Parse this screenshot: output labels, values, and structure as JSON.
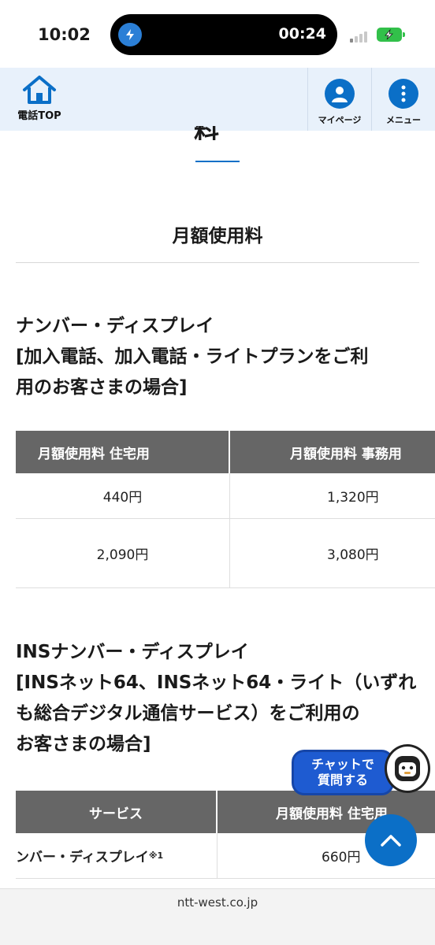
{
  "status_bar": {
    "time": "10:02",
    "timer": "00:24"
  },
  "nav": {
    "home_label": "電話TOP",
    "mypage_label": "マイページ",
    "menu_label": "メニュー"
  },
  "page": {
    "partial_heading": "料金",
    "section_title": "月額使用料",
    "subsection1": {
      "title_lines": [
        "ナンバー・ディスプレイ",
        "[加入電話、加入電話・ライトプランをご利",
        "用のお客さまの場合]"
      ],
      "headers": [
        "月額使用料 住宅用",
        "月額使用料 事務用"
      ],
      "rows": [
        [
          "440円",
          "1,320円"
        ],
        [
          "2,090円",
          "3,080円"
        ]
      ]
    },
    "subsection2": {
      "title_lines": [
        "INSナンバー・ディスプレイ",
        "[INSネット64、INSネット64・ライト（いずれ",
        "も総合デジタル通信サービス）をご利用の",
        "お客さまの場合]"
      ],
      "headers": [
        "サービス",
        "月額使用料 住宅用"
      ],
      "rows": [
        [
          "ンバー・ディスプレイ",
          "660円"
        ]
      ],
      "footnote_mark": "※1"
    }
  },
  "chat": {
    "line1": "チャットで",
    "line2": "質問する"
  },
  "footer": {
    "url": "ntt-west.co.jp"
  },
  "colors": {
    "accent": "#0b6fc7",
    "nav_bg": "#e8f1fb",
    "table_header": "#666666",
    "chat": "#1e5bd1"
  }
}
